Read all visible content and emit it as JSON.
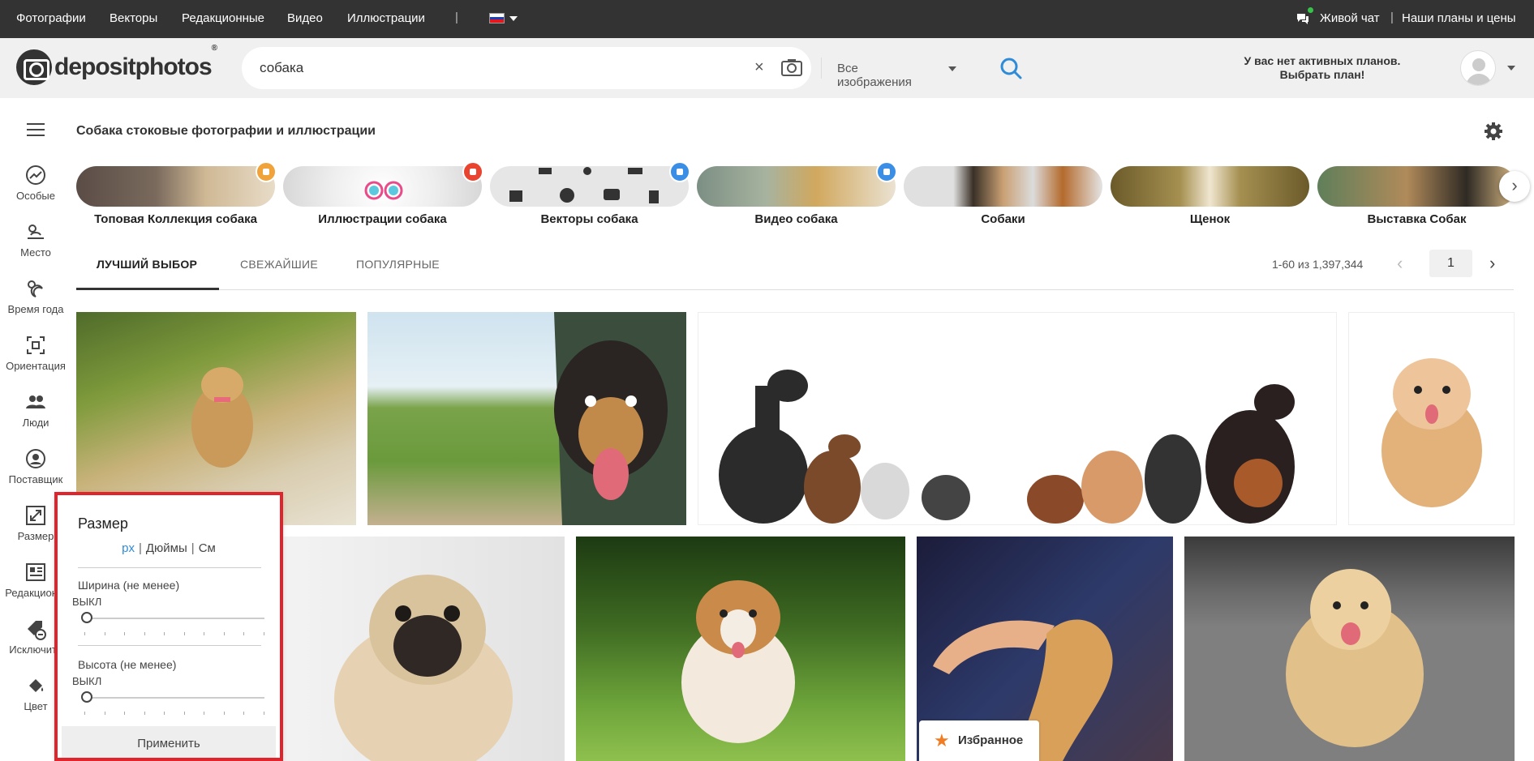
{
  "topnav": {
    "links": [
      "Фотографии",
      "Векторы",
      "Редакционные",
      "Видео",
      "Иллюстрации"
    ],
    "separator": "|",
    "live_chat": "Живой чат",
    "right_separator": "|",
    "plans_prices": "Наши планы и цены",
    "flag_colors": [
      "#ffffff",
      "#1c3fb7",
      "#e4181c"
    ]
  },
  "header": {
    "logo_text": "depositphotos",
    "logo_mark": "®",
    "search_query": "собака",
    "clear_label": "×",
    "search_type": "Все изображения",
    "plan_line1": "У вас нет активных планов.",
    "plan_line2": "Выбрать план!"
  },
  "sidebar": {
    "items": [
      {
        "label": "Особые",
        "icon": "trending-icon"
      },
      {
        "label": "Место",
        "icon": "weather-location-icon"
      },
      {
        "label": "Время года",
        "icon": "season-icon"
      },
      {
        "label": "Ориентация",
        "icon": "orientation-icon"
      },
      {
        "label": "Люди",
        "icon": "people-icon"
      },
      {
        "label": "Поставщик",
        "icon": "contributor-icon"
      },
      {
        "label": "Размер",
        "icon": "resize-icon"
      },
      {
        "label": "Редакцион...",
        "icon": "editorial-icon"
      },
      {
        "label": "Исключить",
        "icon": "exclude-tag-icon"
      },
      {
        "label": "Цвет",
        "icon": "paint-bucket-icon"
      }
    ]
  },
  "page_title": "Собака стоковые фотографии и иллюстрации",
  "categories": [
    {
      "label": "Топовая Коллекция собака",
      "badge": "crown-icon",
      "badge_color": "#f0a33a"
    },
    {
      "label": "Иллюстрации собака",
      "badge": "brush-icon",
      "badge_color": "#e8442f"
    },
    {
      "label": "Векторы собака",
      "badge": "pen-icon",
      "badge_color": "#3a8ee6"
    },
    {
      "label": "Видео собака",
      "badge": "camera-icon",
      "badge_color": "#3a8ee6"
    },
    {
      "label": "Собаки",
      "badge": ""
    },
    {
      "label": "Щенок",
      "badge": ""
    },
    {
      "label": "Выставка Собак",
      "badge": ""
    }
  ],
  "tabs": [
    "ЛУЧШИЙ ВЫБОР",
    "СВЕЖАЙШИЕ",
    "ПОПУЛЯРНЫЕ"
  ],
  "pagination": {
    "count_text": "1-60 из 1,397,344",
    "page": "1",
    "prev": "‹",
    "next": "›"
  },
  "favorite_label": "Избранное",
  "size_filter": {
    "title": "Размер",
    "units": [
      "px",
      "Дюймы",
      "См"
    ],
    "unit_separator": "|",
    "active_unit": "px",
    "width_label": "Ширина (не менее)",
    "width_value": "ВЫКЛ",
    "height_label": "Высота (не менее)",
    "height_value": "ВЫКЛ",
    "apply": "Применить"
  },
  "colors": {
    "topbar": "#333333",
    "header": "#f0f0f0",
    "accent": "#2e8bd8",
    "highlight_box": "#e1232b"
  }
}
